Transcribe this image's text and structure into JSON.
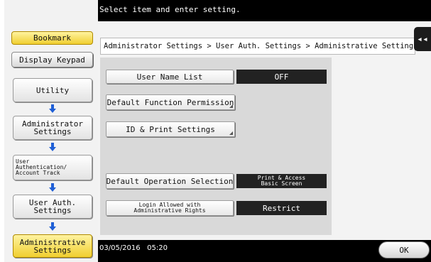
{
  "header": {
    "message": "Select item and enter setting."
  },
  "sidebar": {
    "bookmark_label": "Bookmark",
    "display_keypad_label": "Display Keypad",
    "crumbs": [
      {
        "line1": "Utility",
        "line2": ""
      },
      {
        "line1": "Administrator",
        "line2": "Settings"
      },
      {
        "line1": "User",
        "line2": "Authentication/",
        "line3": "Account Track"
      },
      {
        "line1": "User Auth.",
        "line2": "Settings"
      },
      {
        "line1": "Administrative",
        "line2": "Settings"
      }
    ],
    "arrow_icon": "down-arrow-icon"
  },
  "breadcrumb": "Administrator Settings > User Auth. Settings > Administrative Settings",
  "tab_handle_glyph": "◂◂",
  "settings": {
    "user_name_list": {
      "label": "User Name List",
      "value": "OFF"
    },
    "default_function_permission": {
      "label": "Default Function Permission"
    },
    "id_print_settings": {
      "label": "ID & Print Settings"
    },
    "default_operation_selection": {
      "label": "Default Operation Selection",
      "value_line1": "Print & Access",
      "value_line2": "Basic Screen"
    },
    "login_allowed": {
      "label_line1": "Login Allowed with",
      "label_line2": "Administrative Rights",
      "value": "Restrict"
    }
  },
  "footer": {
    "datetime": "03/05/2016   05:20",
    "ok_label": "OK"
  },
  "colors": {
    "accent_yellow": "#f0cf30",
    "value_bg": "#222222",
    "arrow_blue": "#1f5fd6"
  }
}
